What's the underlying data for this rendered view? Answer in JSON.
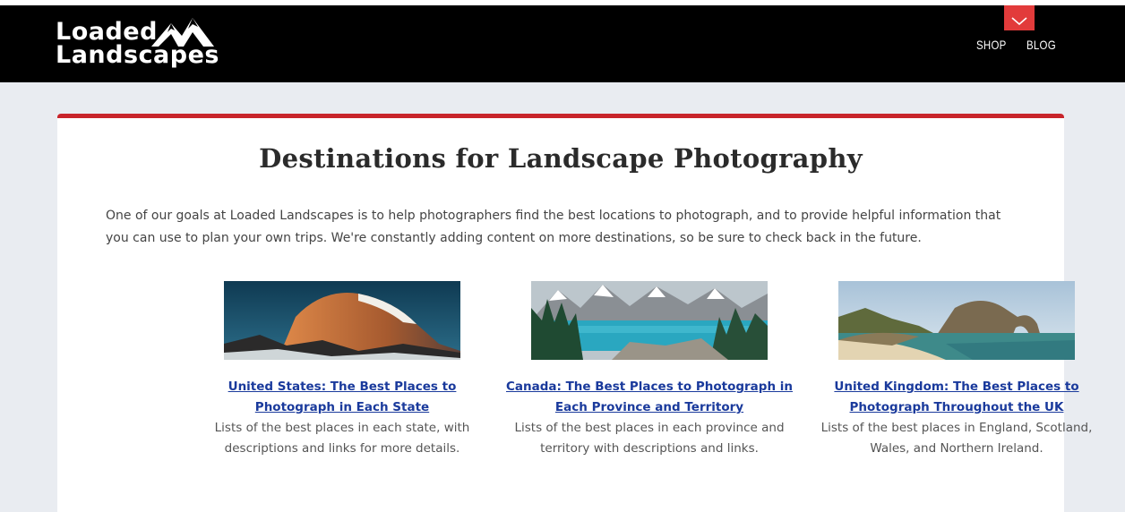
{
  "header": {
    "logo_line1": "Loaded",
    "logo_line2": "Landscapes",
    "nav": [
      {
        "label": "SHOP"
      },
      {
        "label": "BLOG"
      }
    ],
    "menu_icon": "chevron-down-icon",
    "accent_color": "#e23b3b"
  },
  "page": {
    "title": "Destinations for Landscape Photography",
    "intro": "One of our goals at Loaded Landscapes is to help photographers find the best locations to photograph, and to provide helpful information that you can use to plan your own trips. We're constantly adding content on more destinations, so be sure to check back in the future.",
    "accent_color": "#c8242b",
    "link_color": "#1a3a9c"
  },
  "destinations": [
    {
      "link": "United States: The Best Places to Photograph in Each State",
      "description": "Lists of the best places in each state, with descriptions and links for more details."
    },
    {
      "link": "Canada: The Best Places to Photograph in Each Province and Territory",
      "description": "Lists of the best places in each province and territory with descriptions and links."
    },
    {
      "link": "United Kingdom: The Best Places to Photograph Throughout the UK",
      "description": "Lists of the best places in England, Scotland, Wales, and Northern Ireland."
    }
  ]
}
